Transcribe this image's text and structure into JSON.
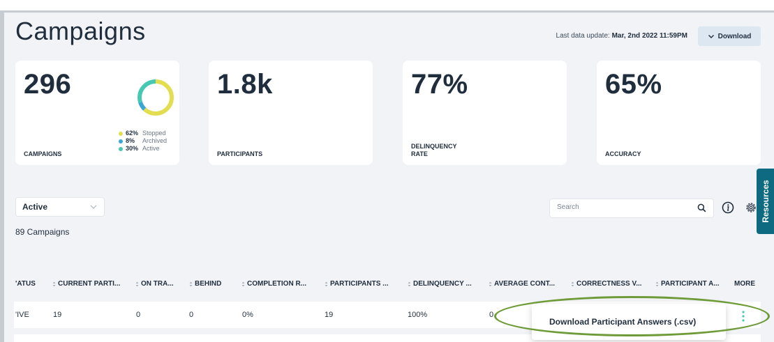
{
  "header": {
    "title": "Campaigns",
    "last_update_label": "Last data update:",
    "last_update_value": "Mar, 2nd 2022 11:59PM",
    "download_label": "Download"
  },
  "stats": {
    "campaigns": {
      "value": "296",
      "label": "CAMPAIGNS",
      "legend": [
        {
          "pct": "62%",
          "name": "Stopped",
          "color": "#e3dd52"
        },
        {
          "pct": "8%",
          "name": "Archived",
          "color": "#3aa6d6"
        },
        {
          "pct": "30%",
          "name": "Active",
          "color": "#46c8b3"
        }
      ]
    },
    "participants": {
      "value": "1.8k",
      "label": "PARTICIPANTS"
    },
    "delinquency": {
      "value": "77%",
      "label_line1": "DELINQUENCY",
      "label_line2": "RATE"
    },
    "accuracy": {
      "value": "65%",
      "label": "ACCURACY"
    }
  },
  "filters": {
    "status_select": "Active",
    "campaign_count": "89 Campaigns",
    "search_placeholder": "Search"
  },
  "resources_tab": "Resources",
  "table": {
    "columns": [
      "'ATUS",
      "CURRENT PARTI...",
      "ON TRA...",
      "BEHIND",
      "COMPLETION R...",
      "PARTICIPANTS ...",
      "DELINQUENCY ...",
      "AVERAGE CONT...",
      "CORRECTNESS V...",
      "PARTICIPANT A...",
      "MORE"
    ],
    "rows": [
      {
        "status": "'IVE",
        "current": "19",
        "on_track": "0",
        "behind": "0",
        "completion": "0%",
        "participants": "19",
        "delinquency": "100%",
        "average": "0"
      }
    ]
  },
  "more_menu": {
    "item": "Download Participant Answers (.csv)"
  },
  "colors": {
    "background": "#f1f3f6",
    "resources_tab": "#0d6a80",
    "highlight_ellipse": "#6e9b38",
    "kebab": "#46c8b3"
  }
}
